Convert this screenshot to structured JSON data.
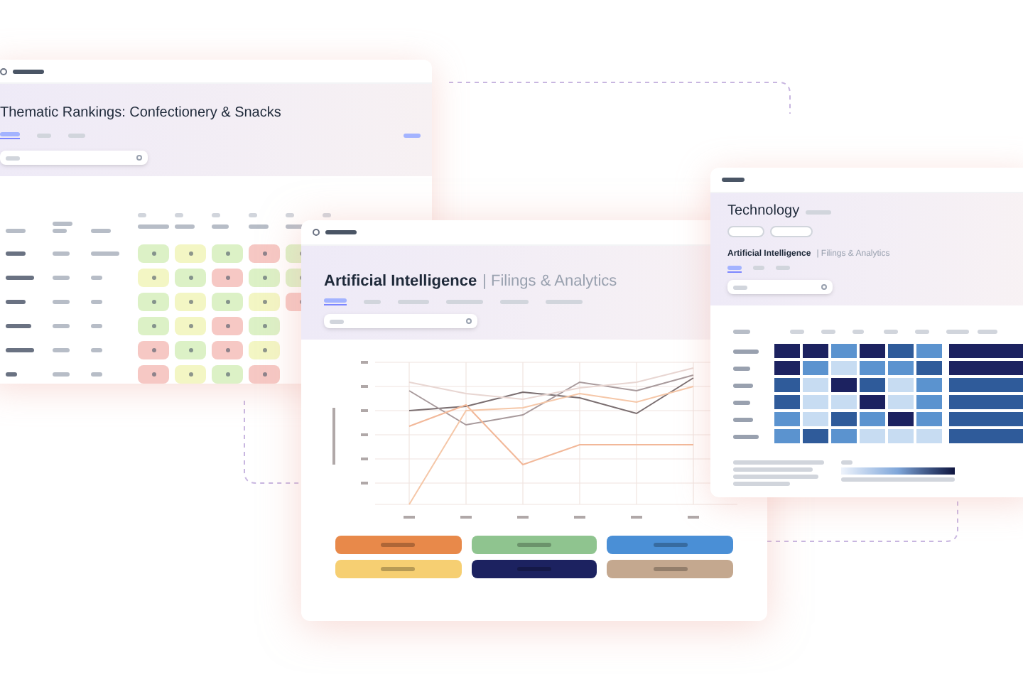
{
  "rankings_window": {
    "title": "Thematic Rankings: Confectionery & Snacks",
    "rows": [
      {
        "cells": [
          {
            "color": "#dcf1c6"
          },
          {
            "color": "#f3f6c4"
          },
          {
            "color": "#dcf1c6"
          },
          {
            "color": "#f6c8c4"
          },
          {
            "color": "#dcf1c6"
          }
        ]
      },
      {
        "cells": [
          {
            "color": "#f3f6c4"
          },
          {
            "color": "#dcf1c6"
          },
          {
            "color": "#f6c8c4"
          },
          {
            "color": "#dcf1c6"
          },
          {
            "color": "#dcf1c6"
          }
        ]
      },
      {
        "cells": [
          {
            "color": "#dcf1c6"
          },
          {
            "color": "#f3f6c4"
          },
          {
            "color": "#dcf1c6"
          },
          {
            "color": "#f3f6c4"
          },
          {
            "color": "#f6c8c4"
          }
        ]
      },
      {
        "cells": [
          {
            "color": "#dcf1c6"
          },
          {
            "color": "#f3f6c4"
          },
          {
            "color": "#f6c8c4"
          },
          {
            "color": "#dcf1c6"
          }
        ]
      },
      {
        "cells": [
          {
            "color": "#f6c8c4"
          },
          {
            "color": "#dcf1c6"
          },
          {
            "color": "#f6c8c4"
          },
          {
            "color": "#f3f6c4"
          }
        ]
      },
      {
        "cells": [
          {
            "color": "#f6c8c4"
          },
          {
            "color": "#f3f6c4"
          },
          {
            "color": "#dcf1c6"
          },
          {
            "color": "#f6c8c4"
          }
        ]
      }
    ]
  },
  "filings_window": {
    "title": "Artificial Intelligence",
    "subtitle": "| Filings & Analytics",
    "legend": [
      {
        "color": "#e8894a"
      },
      {
        "color": "#8fc48f"
      },
      {
        "color": "#4a8fd6"
      },
      {
        "color": "#f6cf72"
      },
      {
        "color": "#1c2260"
      },
      {
        "color": "#c4a88f"
      }
    ]
  },
  "technology_window": {
    "title": "Technology",
    "section_title": "Artificial Intelligence",
    "section_subtitle": "| Filings & Analytics",
    "heatmap": [
      {
        "cells": [
          {
            "color": "#1c2260"
          },
          {
            "color": "#1c2260"
          },
          {
            "color": "#5b93cf"
          },
          {
            "color": "#1c2260"
          },
          {
            "color": "#2f5b9a"
          },
          {
            "color": "#5b93cf"
          },
          {
            "color": "#1c2260"
          }
        ]
      },
      {
        "cells": [
          {
            "color": "#1c2260"
          },
          {
            "color": "#5b93cf"
          },
          {
            "color": "#c7dcf2"
          },
          {
            "color": "#5b93cf"
          },
          {
            "color": "#5b93cf"
          },
          {
            "color": "#2f5b9a"
          },
          {
            "color": "#1c2260"
          }
        ]
      },
      {
        "cells": [
          {
            "color": "#2f5b9a"
          },
          {
            "color": "#c7dcf2"
          },
          {
            "color": "#1c2260"
          },
          {
            "color": "#2f5b9a"
          },
          {
            "color": "#c7dcf2"
          },
          {
            "color": "#5b93cf"
          },
          {
            "color": "#2f5b9a"
          }
        ]
      },
      {
        "cells": [
          {
            "color": "#2f5b9a"
          },
          {
            "color": "#c7dcf2"
          },
          {
            "color": "#c7dcf2"
          },
          {
            "color": "#1c2260"
          },
          {
            "color": "#c7dcf2"
          },
          {
            "color": "#5b93cf"
          },
          {
            "color": "#2f5b9a"
          }
        ]
      },
      {
        "cells": [
          {
            "color": "#5b93cf"
          },
          {
            "color": "#c7dcf2"
          },
          {
            "color": "#2f5b9a"
          },
          {
            "color": "#5b93cf"
          },
          {
            "color": "#1c2260"
          },
          {
            "color": "#5b93cf"
          },
          {
            "color": "#2f5b9a"
          }
        ]
      },
      {
        "cells": [
          {
            "color": "#5b93cf"
          },
          {
            "color": "#2f5b9a"
          },
          {
            "color": "#5b93cf"
          },
          {
            "color": "#c7dcf2"
          },
          {
            "color": "#c7dcf2"
          },
          {
            "color": "#c7dcf2"
          },
          {
            "color": "#2f5b9a"
          }
        ]
      }
    ]
  }
}
